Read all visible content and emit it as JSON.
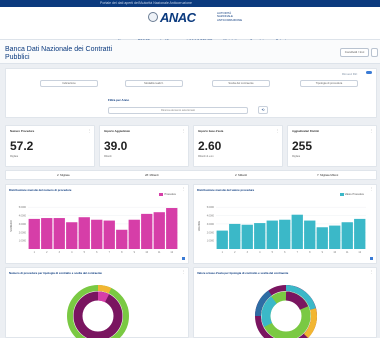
{
  "topbar": {
    "text": "Portale dei dati aperti dell'Autorità Nazionale Anticorruzione"
  },
  "header": {
    "logo_text": "ANAC",
    "logo_sub": "AUTORITÀ NAZIONALE ANTICORRUZIONE",
    "nav": [
      "Home",
      "BDNCP",
      "Le Misure",
      "L'ANAC BDNCP",
      "Altri dati e",
      "Opendata",
      "Dataviz"
    ]
  },
  "page": {
    "title": "Banca Dati Nazionale dei Contratti Pubblici"
  },
  "actions": {
    "condividi_label": "Condividi / Invi"
  },
  "filters": {
    "link_label": "Rimuovi filtri",
    "chips": [
      "Indicazione",
      "Modalità realizz.",
      "Scelta del contraente",
      "Tipologia di procedura"
    ],
    "filter_by_label": "Filtra per Anno",
    "search_placeholder": "Ricerca elemento selezionato",
    "clear_icon": "refresh-icon"
  },
  "kpis": [
    {
      "label": "Numero Procedure",
      "value": "57.2",
      "unit": "Migliaia"
    },
    {
      "label": "Importo Aggiudicato",
      "value": "39.0",
      "unit": "Miliardi"
    },
    {
      "label": "Importo base d'asta",
      "value": "2.60",
      "unit": "Miliardi di euro"
    },
    {
      "label": "Aggiudicatari Distinti",
      "value": "255",
      "unit": "Migliaia"
    }
  ],
  "summary": [
    {
      "label": "2: Migliaia"
    },
    {
      "label": "28: Miliardi"
    },
    {
      "label": "2: Miliardi"
    },
    {
      "label": "7: Migliaia Milioni"
    }
  ],
  "charts": {
    "left_title": "Distribuzione mensile del numero di procedure",
    "right_title": "Distribuzione mensile del valore procedure",
    "donut_left_title": "Numero di procedure per tipologia di contratto e scelta del contraente",
    "donut_right_title": "Valore a base d'asta per tipologia di contratto e scelta del contraente",
    "colors": {
      "pink": "#d63ea8",
      "teal": "#3bb8c8",
      "navy": "#0b3a7e"
    }
  },
  "chart_data": [
    {
      "type": "bar",
      "title": "Distribuzione mensile del numero di procedure",
      "series": [
        {
          "name": "Procedure",
          "values": [
            3.6,
            3.7,
            3.7,
            3.2,
            3.8,
            3.5,
            3.4,
            2.3,
            3.5,
            4.2,
            4.4,
            4.9
          ]
        }
      ],
      "categories": [
        "1",
        "2",
        "3",
        "4",
        "5",
        "6",
        "7",
        "8",
        "9",
        "10",
        "11",
        "12"
      ],
      "xlabel": "",
      "ylabel": "NUMERO",
      "yticks": [
        "1.0000",
        "2.0000",
        "3.0000",
        "4.0000",
        "5.0000"
      ],
      "ylim": [
        0,
        5.5
      ]
    },
    {
      "type": "bar",
      "title": "Distribuzione mensile del valore procedure",
      "series": [
        {
          "name": "Valore Procedure",
          "values": [
            2.2,
            3.0,
            2.9,
            3.1,
            3.4,
            3.5,
            4.1,
            3.4,
            2.6,
            2.8,
            3.2,
            3.6
          ]
        }
      ],
      "categories": [
        "1",
        "2",
        "3",
        "4",
        "5",
        "6",
        "7",
        "8",
        "9",
        "10",
        "11",
        "12"
      ],
      "xlabel": "",
      "ylabel": "VALORE",
      "yticks": [
        "1.0000",
        "2.0000",
        "3.0000",
        "4.0000",
        "5.0000"
      ],
      "ylim": [
        0,
        5.5
      ]
    }
  ]
}
